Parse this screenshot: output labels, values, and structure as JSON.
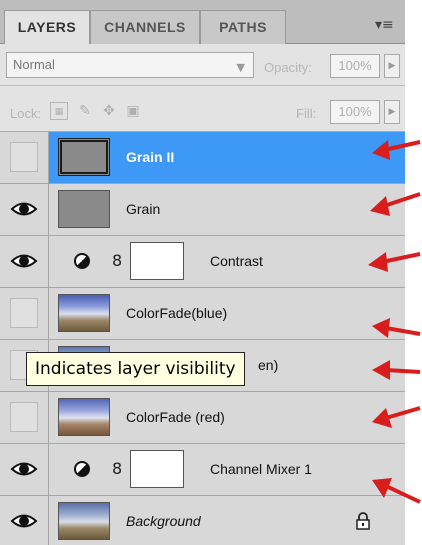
{
  "tabs": [
    {
      "label": "LAYERS",
      "active": true
    },
    {
      "label": "CHANNELS",
      "active": false
    },
    {
      "label": "PATHS",
      "active": false
    }
  ],
  "panel_menu_icon": "panel-menu-icon",
  "blend": {
    "mode": "Normal",
    "opacity_label": "Opacity:",
    "opacity_value": "100%"
  },
  "lock": {
    "label": "Lock:",
    "fill_label": "Fill:",
    "fill_value": "100%"
  },
  "layers": [
    {
      "name": "Grain II",
      "visible": false,
      "selected": true,
      "kind": "grain"
    },
    {
      "name": "Grain",
      "visible": true,
      "selected": false,
      "kind": "grain"
    },
    {
      "name": "Contrast",
      "visible": true,
      "selected": false,
      "kind": "adjustment"
    },
    {
      "name": "ColorFade(blue)",
      "visible": false,
      "selected": false,
      "kind": "photo"
    },
    {
      "name": "en)",
      "visible": false,
      "selected": false,
      "kind": "photo"
    },
    {
      "name": "ColorFade (red)",
      "visible": false,
      "selected": false,
      "kind": "photo"
    },
    {
      "name": "Channel Mixer 1",
      "visible": true,
      "selected": false,
      "kind": "adjustment"
    },
    {
      "name": "Background",
      "visible": true,
      "selected": false,
      "kind": "photo",
      "locked": true
    }
  ],
  "tooltip": "Indicates layer visibility",
  "annotation_color": "#d91c1c",
  "selection_color": "#3d98f6"
}
